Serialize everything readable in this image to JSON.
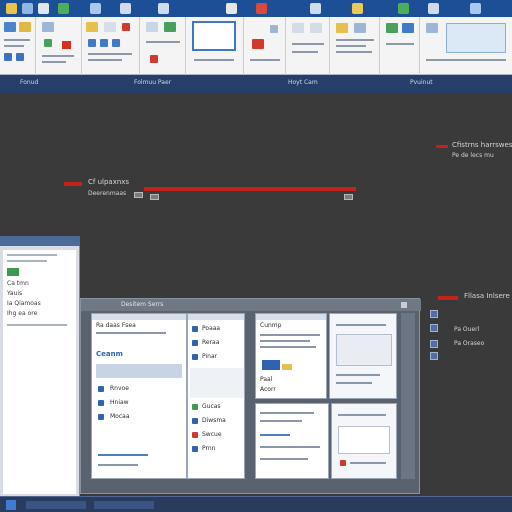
{
  "ribbon": {
    "group_labels": [
      "Fonud",
      "Folmuu Paer",
      "Hoyt Cam",
      "Pvuinut"
    ]
  },
  "canvas": {
    "callout_top_right": {
      "title": "Cfistrns harrswesrs",
      "subtitle": "Pe de lecs mu"
    },
    "callout_mid_left": {
      "title": "Cf ulpaxnxs",
      "subtitle": "Deerenmaas"
    },
    "callout_right": {
      "title": "Fllasa Inlsere",
      "line1": "Pa Ouerl",
      "line2": "Pa Oraseo"
    }
  },
  "left_panel": {
    "rows": [
      "Ca tmn",
      "Yauis",
      "Ia Qiamoas",
      "Ihg ea ore"
    ]
  },
  "window_cluster": {
    "title": "Desitem Serrs",
    "pane_a": {
      "header": "Ra daas Fsea",
      "label": "Ceanm",
      "items": [
        "Rnvoe",
        "Hniaw",
        "Mocaa"
      ]
    },
    "pane_b": {
      "items": [
        "Poaaa",
        "Reraa",
        "Pinar",
        "Gucas",
        "Diwsma",
        "Swcue",
        "Prnn"
      ]
    },
    "pane_c": {
      "header": "Cunmp",
      "items": [
        "Paal",
        "Acorr"
      ]
    }
  },
  "colors": {
    "accent_red": "#c5221b",
    "ribbon_blue": "#1d4f96"
  }
}
